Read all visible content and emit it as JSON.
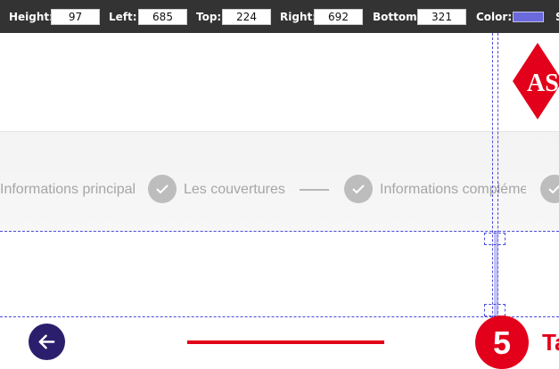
{
  "measure_tool": {
    "height_label": "Height:",
    "height_value": "97",
    "left_label": "Left:",
    "left_value": "685",
    "top_label": "Top:",
    "top_value": "224",
    "right_label": "Right:",
    "right_value": "692",
    "bottom_label": "Bottom:",
    "bottom_value": "321",
    "color_label": "Color:",
    "color_value": "#6a6adc",
    "cut_label": "S"
  },
  "header": {
    "logo_text": "AS",
    "logo_color": "#e2001a"
  },
  "stepper": {
    "steps": [
      {
        "label": "Informations principales",
        "state": "completed"
      },
      {
        "label": "Les couvertures",
        "state": "completed"
      },
      {
        "label": "Informations complémentaires",
        "state": "completed"
      },
      {
        "label": "",
        "state": "completed"
      }
    ]
  },
  "footer_nav": {
    "back_icon": "arrow-left-icon",
    "current_step_number": "5",
    "current_step_title": "Ta",
    "accent_color": "#e2001a",
    "back_color": "#2b1f6d"
  }
}
